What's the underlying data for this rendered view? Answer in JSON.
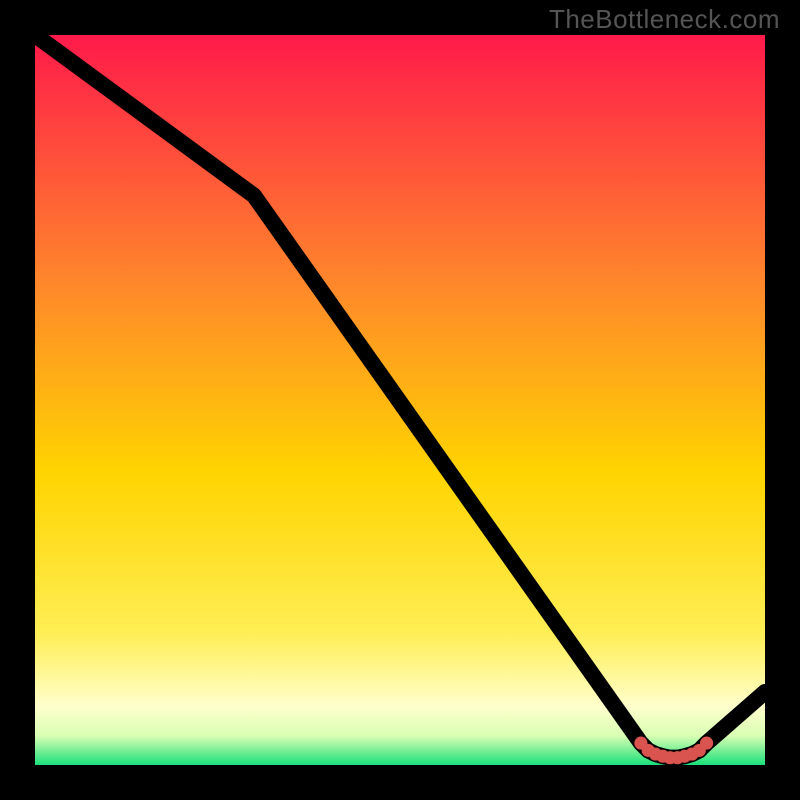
{
  "watermark": "TheBottleneck.com",
  "colors": {
    "top": "#ff1a4a",
    "mid_upper": "#ff8a2a",
    "mid": "#ffd400",
    "mid_lower1": "#ffee55",
    "mid_lower2": "#ffffcc",
    "near_bottom": "#d9ffb3",
    "bottom": "#19e07a",
    "curve": "#000000",
    "marker": "#d9534f",
    "background": "#000000"
  },
  "chart_data": {
    "type": "line",
    "title": "",
    "xlabel": "",
    "ylabel": "",
    "xlim": [
      0,
      100
    ],
    "ylim": [
      0,
      100
    ],
    "grid": false,
    "series": [
      {
        "name": "curve",
        "x": [
          0,
          30,
          83,
          84,
          85,
          86,
          87,
          88,
          89,
          90,
          91,
          92,
          100
        ],
        "y": [
          100,
          78,
          3,
          2,
          1.5,
          1.2,
          1,
          1,
          1.2,
          1.5,
          2,
          3,
          10
        ]
      }
    ],
    "markers": {
      "name": "highlight",
      "x": [
        83,
        84,
        85,
        86,
        87,
        88,
        89,
        90,
        91,
        92
      ],
      "y": [
        3,
        2,
        1.5,
        1.2,
        1,
        1,
        1.2,
        1.5,
        2,
        3
      ]
    }
  }
}
